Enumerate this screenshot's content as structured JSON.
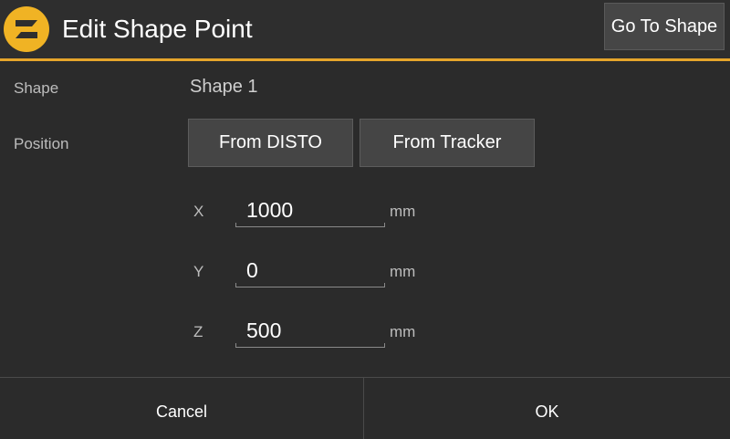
{
  "header": {
    "title": "Edit Shape Point",
    "goto_label": "Go To Shape",
    "logo_icon": "app-logo-icon",
    "accent_color": "#e6a52b"
  },
  "shape": {
    "label": "Shape",
    "value": "Shape 1"
  },
  "position": {
    "label": "Position",
    "from_disto_label": "From DISTO",
    "from_tracker_label": "From Tracker"
  },
  "coordinates": {
    "x": {
      "label": "X",
      "value": "1000",
      "unit": "mm"
    },
    "y": {
      "label": "Y",
      "value": "0",
      "unit": "mm"
    },
    "z": {
      "label": "Z",
      "value": "500",
      "unit": "mm"
    }
  },
  "footer": {
    "cancel_label": "Cancel",
    "ok_label": "OK"
  }
}
